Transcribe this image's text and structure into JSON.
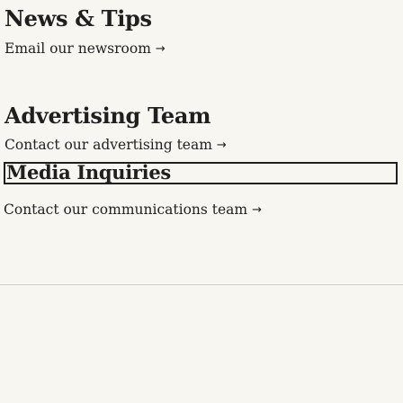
{
  "sections": [
    {
      "heading": "News & Tips",
      "link_label": "Email our newsroom",
      "link_icon": "arrow-right-icon"
    },
    {
      "heading": "Advertising Team",
      "link_label": "Contact our advertising team",
      "link_icon": "arrow-right-icon"
    },
    {
      "heading": "Media Inquiries",
      "link_label": "Contact our communications team",
      "link_icon": "arrow-right-icon",
      "focused": true
    }
  ],
  "glyphs": {
    "arrow": "→"
  },
  "colors": {
    "background": "#f7f6f1",
    "text": "#1f1f1f",
    "focus_border": "#1f1f1f",
    "divider": "#cfcfcf"
  }
}
